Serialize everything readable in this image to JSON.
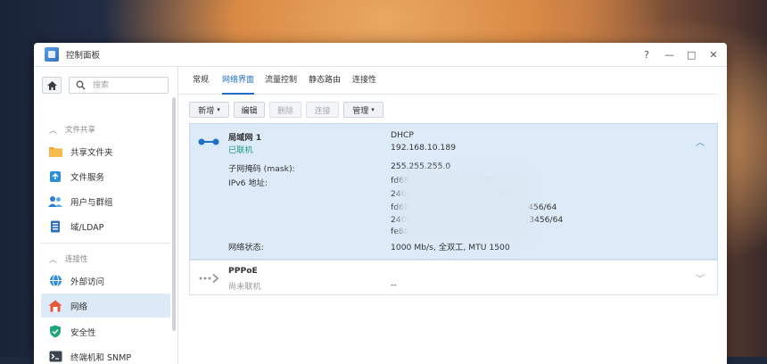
{
  "window": {
    "title": "控制面板",
    "controls": [
      "?",
      "—",
      "□",
      "✕"
    ]
  },
  "sidebar": {
    "search_placeholder": "搜索",
    "groups": [
      {
        "label": "文件共享",
        "items": [
          {
            "label": "共享文件夹",
            "icon": "folder-icon"
          },
          {
            "label": "文件服务",
            "icon": "file-services-icon"
          },
          {
            "label": "用户与群组",
            "icon": "users-icon"
          },
          {
            "label": "域/LDAP",
            "icon": "domain-icon"
          }
        ]
      },
      {
        "label": "连接性",
        "items": [
          {
            "label": "外部访问",
            "icon": "external-access-icon"
          },
          {
            "label": "网络",
            "icon": "network-icon",
            "active": true
          },
          {
            "label": "安全性",
            "icon": "shield-icon"
          },
          {
            "label": "终端机和 SNMP",
            "icon": "terminal-icon"
          }
        ]
      }
    ]
  },
  "tabs": [
    {
      "label": "常规"
    },
    {
      "label": "网络界面",
      "active": true
    },
    {
      "label": "流量控制"
    },
    {
      "label": "静态路由"
    },
    {
      "label": "连接性"
    }
  ],
  "toolbar": {
    "create": "新增",
    "edit": "编辑",
    "delete": "删除",
    "connect": "连接",
    "manage": "管理"
  },
  "interfaces": [
    {
      "name": "局域网 1",
      "status": "已联机",
      "mode": "DHCP",
      "ip": "192.168.10.189",
      "mask_label": "子网掩码 (mask):",
      "mask": "255.255.255.0",
      "ipv6_label": "IPv6 地址:",
      "ipv6": [
        "fd68",
        "240e",
        "fd68",
        "240e",
        "fe80"
      ],
      "ipv6_tails": [
        "78",
        "128",
        "456/64",
        ":3456/64",
        ""
      ],
      "net_label": "网络状态:",
      "net": "1000 Mb/s, 全双工, MTU 1500",
      "expanded": true
    },
    {
      "name": "PPPoE",
      "status": "尚未联机",
      "ip": "--",
      "expanded": false
    }
  ],
  "colors": {
    "accent": "#1f6fc5",
    "connected": "#1c9b84",
    "selected_bg": "#ddebf8"
  }
}
